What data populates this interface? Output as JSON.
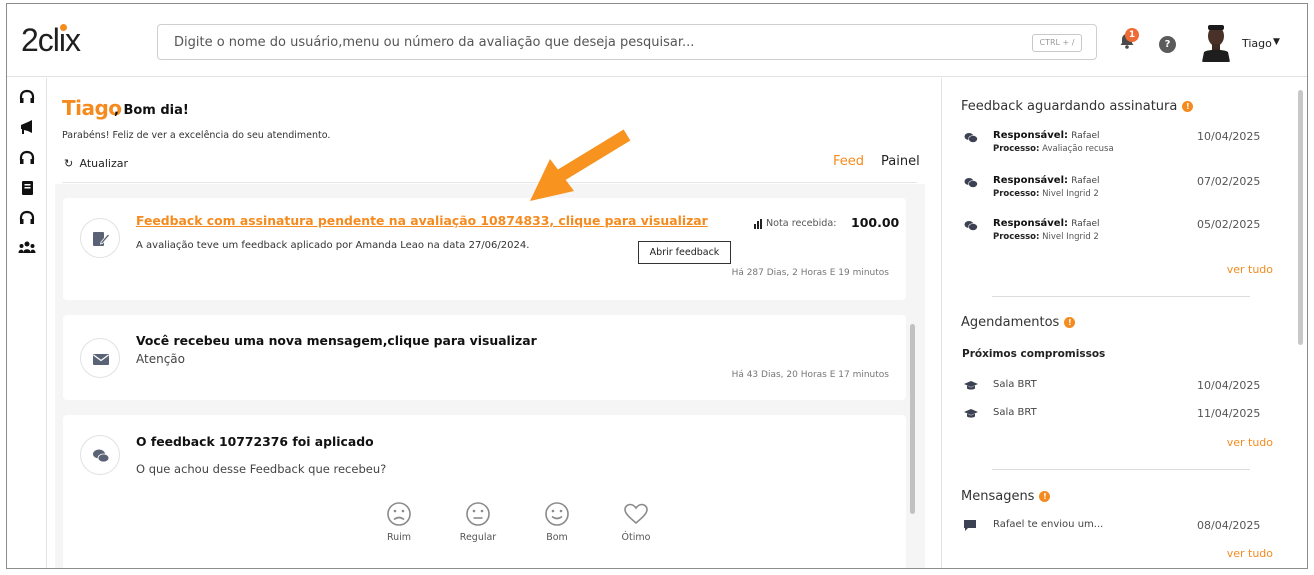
{
  "header": {
    "logo": "2clix",
    "search_placeholder": "Digite o nome do usuário,menu ou número da avaliação que deseja pesquisar...",
    "search_shortcut": "CTRL + /",
    "notifications_count": "1",
    "help_label": "?",
    "user_name": "Tiago"
  },
  "sidebar": {
    "icons": [
      "headset-icon",
      "megaphone-icon",
      "headset-icon",
      "book-icon",
      "headset-icon",
      "users-icon"
    ]
  },
  "greeting": {
    "name": "Tiago",
    "suffix": ", Bom dia!",
    "subtitle": "Parabéns! Feliz de ver a excelência do seu atendimento."
  },
  "toolbar": {
    "refresh_label": "Atualizar",
    "tabs": [
      {
        "label": "Feed",
        "active": true
      },
      {
        "label": "Painel",
        "active": false
      }
    ]
  },
  "feed": {
    "card1": {
      "title": "Feedback com assinatura pendente na avaliação 10874833, clique para visualizar",
      "body": "A avaliação teve um feedback aplicado por Amanda Leao na data 27/06/2024.",
      "nota_label": "Nota recebida:",
      "nota_value": "100.00",
      "tooltip": "Abrir feedback",
      "time": "Há 287 Dias, 2 Horas E 19 minutos"
    },
    "card2": {
      "title": "Você recebeu uma nova mensagem,clique para visualizar",
      "subtitle": "Atenção",
      "time": "Há 43 Dias, 20 Horas E 17 minutos"
    },
    "card3": {
      "title": "O feedback 10772376 foi aplicado",
      "question": "O que achou desse Feedback que recebeu?",
      "ratings": [
        "Ruim",
        "Regular",
        "Bom",
        "Ótimo"
      ]
    }
  },
  "right_panel": {
    "feedback": {
      "heading": "Feedback aguardando assinatura",
      "badge": "!",
      "resp_label": "Responsável:",
      "proc_label": "Processo:",
      "items": [
        {
          "responsavel": "Rafael",
          "processo": "Avaliação recusa",
          "date": "10/04/2025"
        },
        {
          "responsavel": "Rafael",
          "processo": "Nivel Ingrid 2",
          "date": "07/02/2025"
        },
        {
          "responsavel": "Rafael",
          "processo": "Nivel Ingrid 2",
          "date": "05/02/2025"
        }
      ],
      "link": "ver tudo"
    },
    "agendamentos": {
      "heading": "Agendamentos",
      "badge": "!",
      "subheading": "Próximos compromissos",
      "items": [
        {
          "title": "Sala BRT",
          "date": "10/04/2025"
        },
        {
          "title": "Sala BRT",
          "date": "11/04/2025"
        }
      ],
      "link": "ver tudo"
    },
    "mensagens": {
      "heading": "Mensagens",
      "badge": "!",
      "items": [
        {
          "title": "Rafael te enviou um...",
          "date": "08/04/2025"
        }
      ],
      "link": "ver tudo"
    }
  },
  "colors": {
    "accent": "#f58b1f",
    "text": "#222222",
    "muted": "#777777",
    "feed_bg": "#f5f5f5"
  }
}
